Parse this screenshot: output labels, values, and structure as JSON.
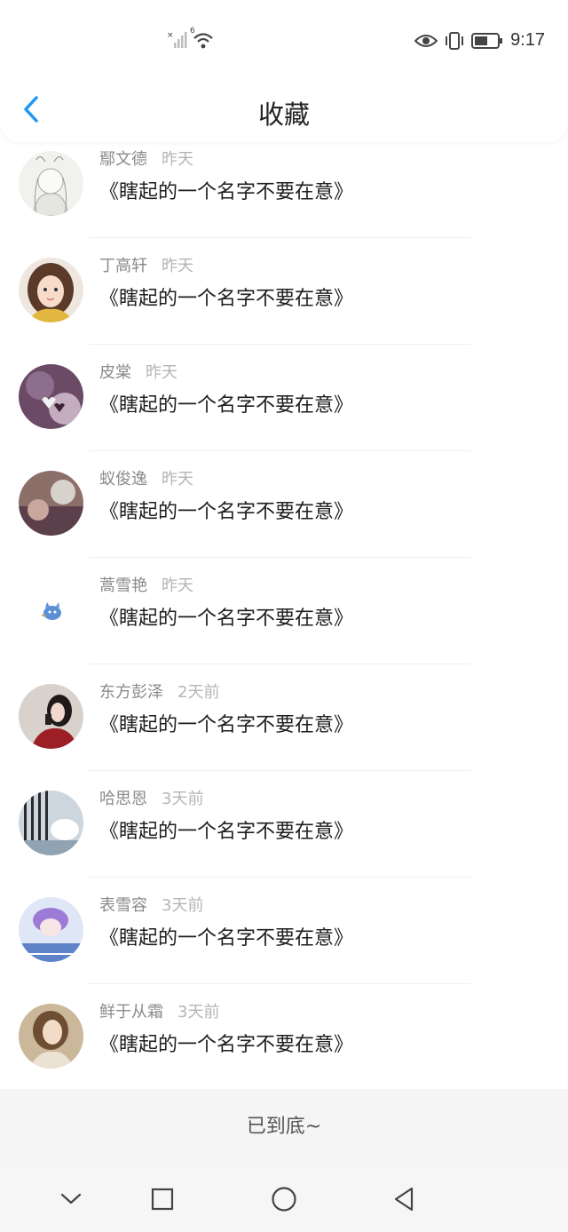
{
  "status_bar": {
    "time": "9:17",
    "signal_badge": "6",
    "icons": [
      "no-sim-signal-icon",
      "wifi-icon",
      "eye-icon",
      "vibrate-icon",
      "battery-icon"
    ]
  },
  "header": {
    "title": "收藏",
    "back_icon": "chevron-left-icon"
  },
  "colors": {
    "accent": "#2196f3",
    "footer_bg": "#f6f5f5"
  },
  "items": [
    {
      "name": "鄢文德",
      "time": "昨天",
      "content": "《瞎起的一个名字不要在意》"
    },
    {
      "name": "丁高轩",
      "time": "昨天",
      "content": "《瞎起的一个名字不要在意》"
    },
    {
      "name": "皮棠",
      "time": "昨天",
      "content": "《瞎起的一个名字不要在意》"
    },
    {
      "name": "蚁俊逸",
      "time": "昨天",
      "content": "《瞎起的一个名字不要在意》"
    },
    {
      "name": "蒿雪艳",
      "time": "昨天",
      "content": "《瞎起的一个名字不要在意》"
    },
    {
      "name": "东方彭泽",
      "time": "2天前",
      "content": "《瞎起的一个名字不要在意》"
    },
    {
      "name": "哈思恩",
      "time": "3天前",
      "content": "《瞎起的一个名字不要在意》"
    },
    {
      "name": "表雪容",
      "time": "3天前",
      "content": "《瞎起的一个名字不要在意》"
    },
    {
      "name": "鲜于从霜",
      "time": "3天前",
      "content": "《瞎起的一个名字不要在意》"
    }
  ],
  "footer": {
    "text": "已到底~"
  },
  "nav_bar": {
    "buttons": [
      "collapse-chevron-icon",
      "recents-square-icon",
      "home-circle-icon",
      "back-triangle-icon"
    ]
  }
}
